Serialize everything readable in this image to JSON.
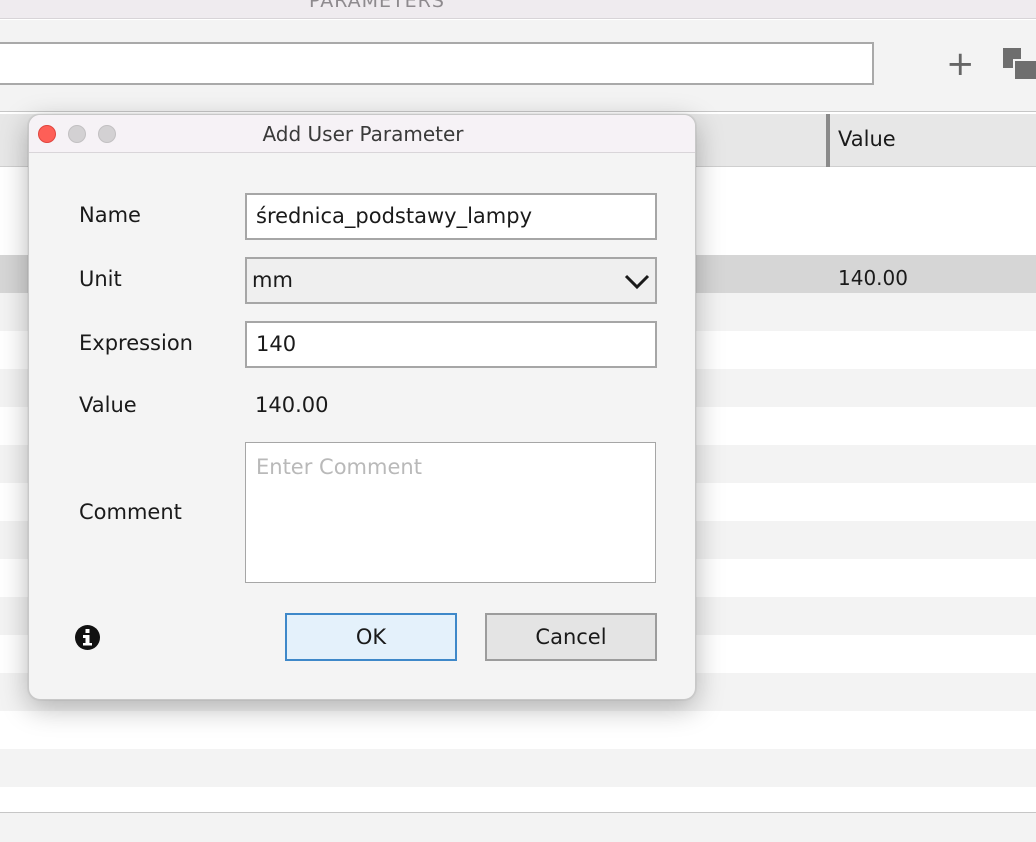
{
  "background_window": {
    "title": "PARAMETERS",
    "search": {
      "value": ""
    },
    "toolbar": {
      "add_icon": "plus-icon",
      "copy_icon": "copy-icon"
    },
    "table": {
      "columns": [
        "Value"
      ],
      "rows": [
        {
          "value": ""
        },
        {
          "value": ""
        },
        {
          "value": "140.00"
        },
        {
          "value": ""
        },
        {
          "value": ""
        },
        {
          "value": ""
        },
        {
          "value": ""
        },
        {
          "value": ""
        },
        {
          "value": ""
        },
        {
          "value": ""
        },
        {
          "value": ""
        },
        {
          "value": ""
        },
        {
          "value": ""
        },
        {
          "value": ""
        },
        {
          "value": ""
        },
        {
          "value": ""
        }
      ]
    }
  },
  "dialog": {
    "title": "Add User Parameter",
    "name": {
      "label": "Name",
      "value": "średnica_podstawy_lampy"
    },
    "unit": {
      "label": "Unit",
      "value": "mm"
    },
    "expression": {
      "label": "Expression",
      "value": "140"
    },
    "value": {
      "label": "Value",
      "value": "140.00"
    },
    "comment": {
      "label": "Comment",
      "placeholder": "Enter Comment",
      "value": ""
    },
    "buttons": {
      "ok": "OK",
      "cancel": "Cancel"
    },
    "info_icon": "info-icon"
  },
  "colors": {
    "ok_border": "#3e88c9",
    "ok_fill": "#e4f1fb",
    "close_button": "#fe5f57",
    "selected_row": "#d6d6d6",
    "stripe_row": "#f3f3f3"
  }
}
